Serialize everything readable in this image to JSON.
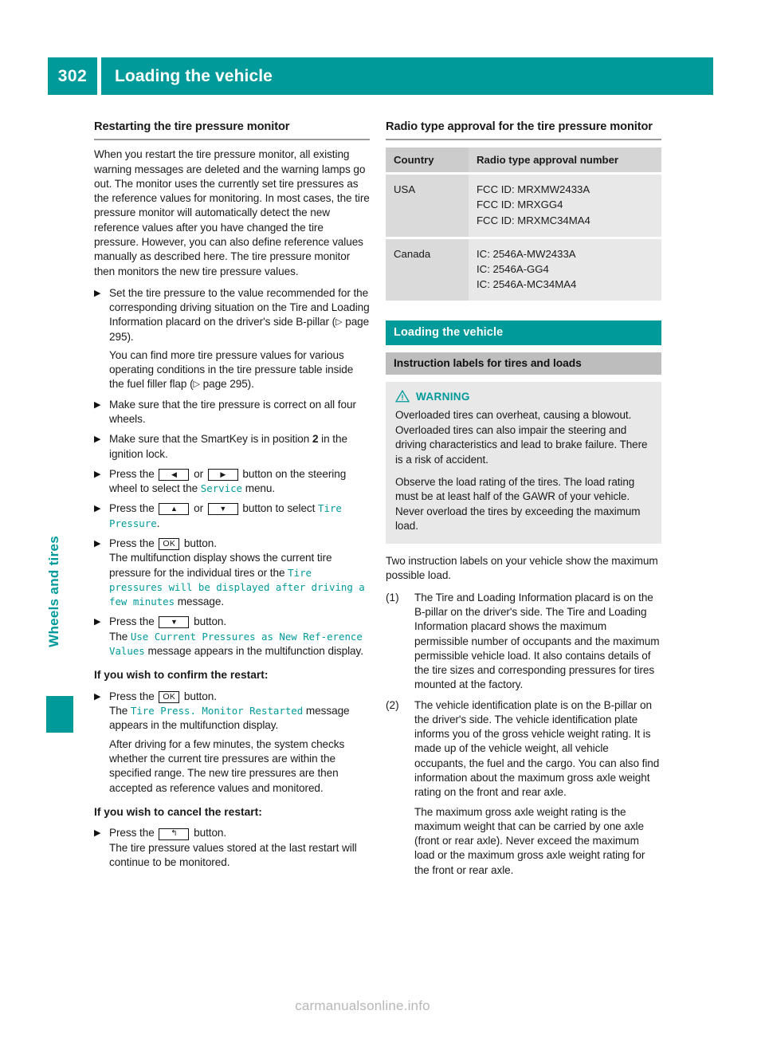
{
  "header": {
    "page_number": "302",
    "title": "Loading the vehicle"
  },
  "side_tab": {
    "label": "Wheels and tires"
  },
  "colors": {
    "accent_teal": "#009a9a",
    "section_gray": "#bdbdbd",
    "box_gray": "#e8e8e8",
    "table_header_gray": "#d5d5d5",
    "footer_gray": "#b7b7b7"
  },
  "left_column": {
    "section_title": "Restarting the tire pressure monitor",
    "intro": "When you restart the tire pressure monitor, all existing warning messages are deleted and the warning lamps go out. The monitor uses the currently set tire pressures as the reference values for monitoring. In most cases, the tire pressure monitor will automatically detect the new reference values after you have changed the tire pressure. However, you can also define reference values manually as described here. The tire pressure monitor then monitors the new tire pressure values.",
    "bullets": [
      {
        "text_1": "Set the tire pressure to the value recommended for the corresponding driving situation on the Tire and Loading Information placard on the driver's side B-pillar (",
        "ref_1": " page 295).",
        "text_2": "You can find more tire pressure values for various operating conditions in the tire pressure table inside the fuel filler flap (",
        "ref_2": " page 295)."
      },
      {
        "text_1": "Make sure that the tire pressure is correct on all four wheels."
      },
      {
        "text_1": "Make sure that the SmartKey is in position ",
        "bold": "2",
        "text_2": " in the ignition lock."
      },
      {
        "text_1": "Press the ",
        "key_1": "left-arrow",
        "text_2": " or ",
        "key_2": "right-arrow",
        "text_3": " button on the steering wheel to select the ",
        "display_1": "Service",
        "text_4": " menu."
      },
      {
        "text_1": "Press the ",
        "key_1": "up-arrow",
        "text_2": " or ",
        "key_2": "down-arrow",
        "text_3": " button to select ",
        "display_1": "Tire Pressure",
        "text_4": "."
      },
      {
        "text_1": "Press the ",
        "key_1": "OK",
        "text_2": " button.",
        "text_3": "The multifunction display shows the current tire pressure for the individual tires or the ",
        "display_1": "Tire pressures will be displayed after driving a few minutes",
        "text_4": " message."
      },
      {
        "text_1": "Press the ",
        "key_1": "down-arrow",
        "text_2": " button.",
        "text_3": "The ",
        "display_1": "Use Current Pressures as New Ref‐erence Values",
        "text_4": " message appears in the multifunction display."
      }
    ],
    "confirm_heading": "If you wish to confirm the restart:",
    "confirm_bullet": {
      "text_1": "Press the ",
      "key_1": "OK",
      "text_2": " button.",
      "text_3": "The ",
      "display_1": "Tire Press. Monitor Restarted",
      "text_4": " message appears in the multifunction display.",
      "text_5": "After driving for a few minutes, the system checks whether the current tire pressures are within the specified range. The new tire pressures are then accepted as reference values and monitored."
    },
    "cancel_heading": "If you wish to cancel the restart:",
    "cancel_bullet": {
      "text_1": "Press the ",
      "key_1": "back-arrow",
      "text_2": " button.",
      "text_3": "The tire pressure values stored at the last restart will continue to be monitored."
    }
  },
  "right_column": {
    "section_title": "Radio type approval for the tire pressure monitor",
    "table": {
      "headers": [
        "Country",
        "Radio type approval number"
      ],
      "rows": [
        {
          "country": "USA",
          "numbers": [
            "FCC ID: MRXMW2433A",
            "FCC ID: MRXGG4",
            "FCC ID: MRXMC34MA4"
          ]
        },
        {
          "country": "Canada",
          "numbers": [
            "IC: 2546A-MW2433A",
            "IC: 2546A-GG4",
            "IC: 2546A-MC34MA4"
          ]
        }
      ]
    },
    "teal_section": "Loading the vehicle",
    "gray_section": "Instruction labels for tires and loads",
    "warning": {
      "title": "WARNING",
      "paragraph_1": "Overloaded tires can overheat, causing a blowout. Overloaded tires can also impair the steering and driving characteristics and lead to brake failure. There is a risk of accident.",
      "paragraph_2": "Observe the load rating of the tires. The load rating must be at least half of the GAWR of your vehicle. Never overload the tires by exceeding the maximum load."
    },
    "intro": "Two instruction labels on your vehicle show the maximum possible load.",
    "items": [
      {
        "number": "(1)",
        "text": "The Tire and Loading Information placard is on the B-pillar on the driver's side. The Tire and Loading Information placard shows the maximum permissible number of occupants and the maximum permissible vehicle load. It also contains details of the tire sizes and corresponding pressures for tires mounted at the factory."
      },
      {
        "number": "(2)",
        "text": "The vehicle identification plate is on the B-pillar on the driver's side. The vehicle identification plate informs you of the gross vehicle weight rating. It is made up of the vehicle weight, all vehicle occupants, the fuel and the cargo. You can also find information about the maximum gross axle weight rating on the front and rear axle.",
        "text_2": "The maximum gross axle weight rating is the maximum weight that can be carried by one axle (front or rear axle). Never exceed the maximum load or the maximum gross axle weight rating for the front or rear axle."
      }
    ]
  },
  "footer": {
    "watermark": "carmanualsonline.info"
  },
  "glyphs": {
    "bullet_marker": "▶",
    "page_ref": "▷",
    "left_arrow": "◀",
    "right_arrow": "▶",
    "up_arrow": "▲",
    "down_arrow": "▼",
    "back_arrow": "↰",
    "ok_label": "OK"
  }
}
